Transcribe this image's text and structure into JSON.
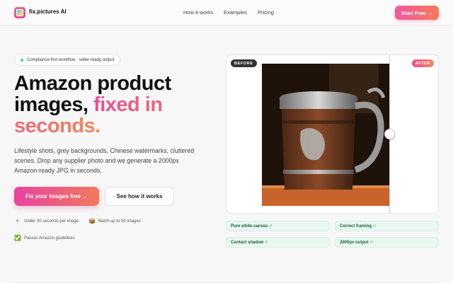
{
  "brand": {
    "name": "fix.pictures AI"
  },
  "nav": {
    "links": [
      "How it works",
      "Examples",
      "Pricing"
    ],
    "cta": "Start Free →"
  },
  "hero": {
    "badge": "Compliance-first workflow · seller-ready output",
    "headline_plain": "Amazon product images, ",
    "headline_accent": "fixed in seconds.",
    "subtext": "Lifestyle shots, grey backgrounds, Chinese watermarks, cluttered scenes. Drop any supplier photo and we generate a 2000px Amazon-ready JPG in seconds.",
    "primary_button": "Fix your images free →",
    "secondary_button": "See how it works",
    "features": [
      {
        "icon": "lightning-icon",
        "glyph": "⚡",
        "text": "Under 30 seconds per image"
      },
      {
        "icon": "box-icon",
        "glyph": "📦",
        "text": "Batch up to 50 images"
      },
      {
        "icon": "check-icon",
        "glyph": "✅",
        "text": "Passes Amazon guidelines"
      }
    ]
  },
  "compare": {
    "before_label": "BEFORE",
    "after_label": "AFTER",
    "chips": [
      "Pure white canvas ✓",
      "Correct framing ✓",
      "Contact shadow ✓",
      "2000px output ✓"
    ]
  },
  "colors": {
    "accent_start": "#ec4d93",
    "accent_end": "#f28a5a",
    "chip_bg": "#e7f8ef"
  }
}
